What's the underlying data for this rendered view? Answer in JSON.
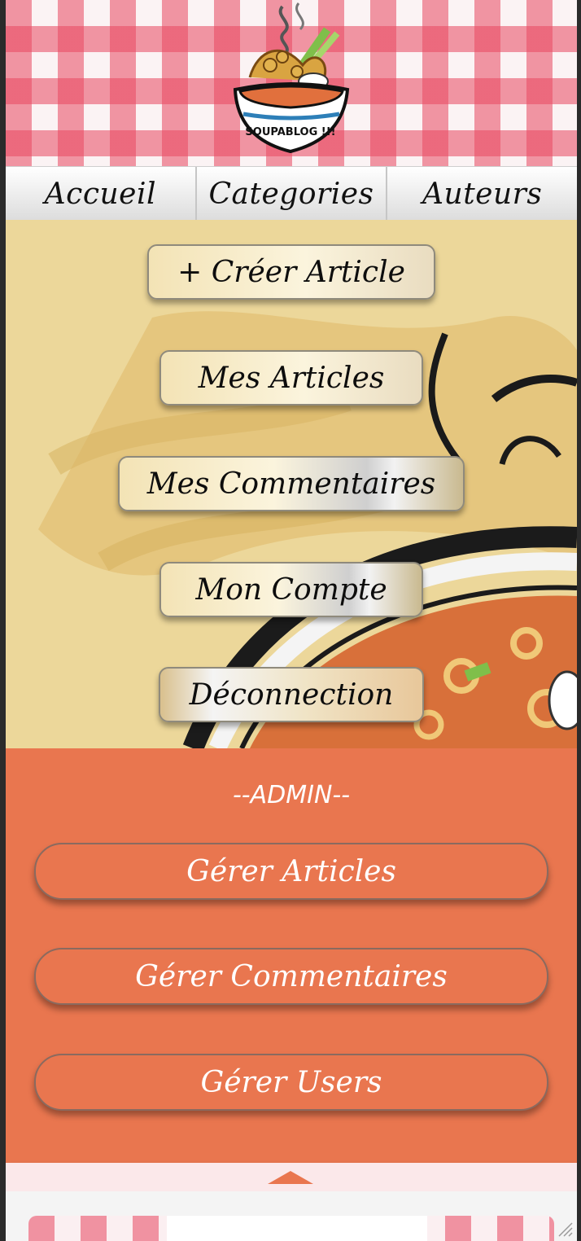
{
  "logo": {
    "text": "SOUPABLOG !!!"
  },
  "nav": {
    "items": [
      {
        "label": "Accueil"
      },
      {
        "label": "Categories"
      },
      {
        "label": "Auteurs"
      }
    ]
  },
  "user_menu": {
    "create_article": "+ Créer Article",
    "my_articles": "Mes Articles",
    "my_comments": "Mes Commentaires",
    "my_account": "Mon Compte",
    "logout": "Déconnection"
  },
  "admin": {
    "title": "--ADMIN--",
    "manage_articles": "Gérer Articles",
    "manage_comments": "Gérer Commentaires",
    "manage_users": "Gérer Users"
  },
  "colors": {
    "gingham_red": "#e8465f",
    "admin_orange": "#e9764f",
    "hero_cream": "#ecd79a"
  },
  "icons": [
    "soup-bowl-logo-icon",
    "scroll-up-arrow-icon",
    "resize-grip-icon"
  ]
}
